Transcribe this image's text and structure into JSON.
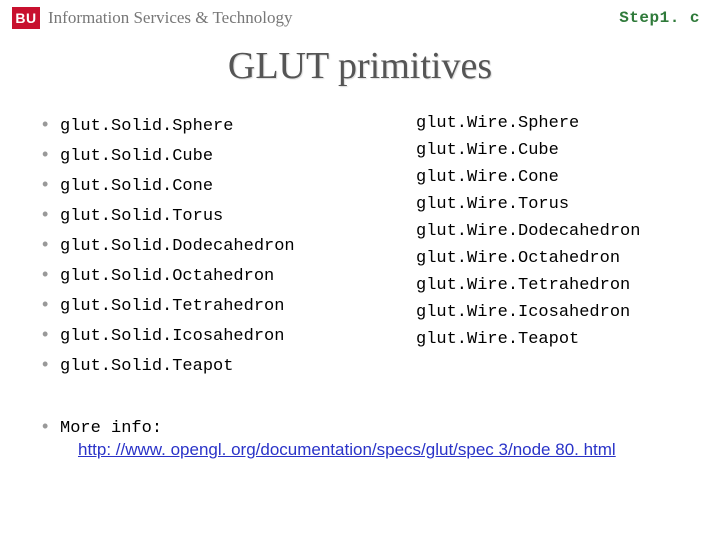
{
  "header": {
    "bu": "BU",
    "ist": "Information Services & Technology",
    "filename": "Step1. c"
  },
  "title": "GLUT primitives",
  "solid": [
    "glut.Solid.Sphere",
    "glut.Solid.Cube",
    "glut.Solid.Cone",
    "glut.Solid.Torus",
    "glut.Solid.Dodecahedron",
    "glut.Solid.Octahedron",
    "glut.Solid.Tetrahedron",
    "glut.Solid.Icosahedron",
    "glut.Solid.Teapot"
  ],
  "wire": [
    "glut.Wire.Sphere",
    "glut.Wire.Cube",
    "glut.Wire.Cone",
    "glut.Wire.Torus",
    "glut.Wire.Dodecahedron",
    "glut.Wire.Octahedron",
    "glut.Wire.Tetrahedron",
    "glut.Wire.Icosahedron",
    "glut.Wire.Teapot"
  ],
  "more": {
    "label": "More info:",
    "url": "http: //www. opengl. org/documentation/specs/glut/spec 3/node 80. html"
  }
}
